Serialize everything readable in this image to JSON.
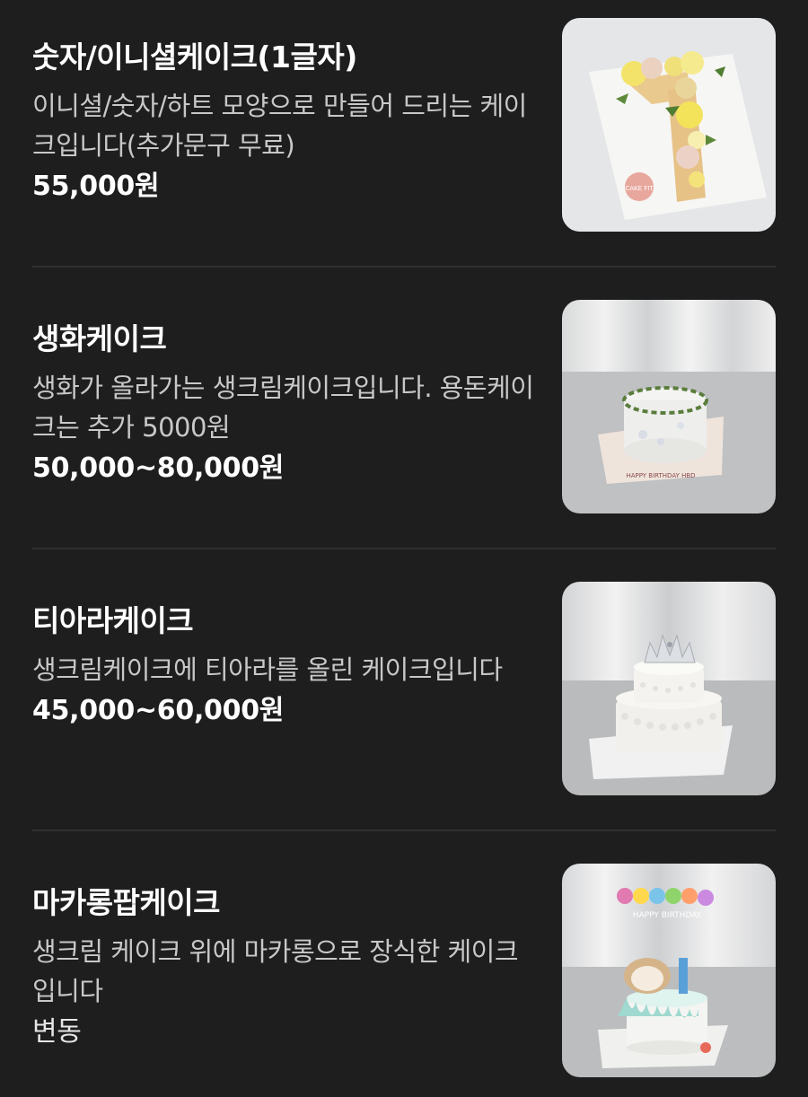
{
  "menu": {
    "items": [
      {
        "name": "숫자/이니셜케이크(1글자)",
        "description": "이니셜/숫자/하트 모양으로 만들어 드리는 케이크입니다(추가문구 무료)",
        "price": "55,000원",
        "image": "number-cake-photo",
        "image_text": "CAKE FIT"
      },
      {
        "name": "생화케이크",
        "description": "생화가 올라가는 생크림케이크입니다. 용돈케이크는 추가 5000원",
        "price": "50,000~80,000원",
        "image": "flower-cake-photo",
        "image_text": "HAPPY BIRTHDAY HBD"
      },
      {
        "name": "티아라케이크",
        "description": "생크림케이크에 티아라를 올린 케이크입니다",
        "price": "45,000~60,000원",
        "image": "tiara-cake-photo"
      },
      {
        "name": "마카롱팝케이크",
        "description": "생크림 케이크 위에 마카롱으로 장식한 케이크입니다",
        "price": "변동",
        "image": "macaron-pop-cake-photo",
        "image_text": "HAPPY BIRTHDAY"
      }
    ]
  },
  "colors": {
    "background": "#1e1e1e",
    "text_primary": "#ffffff",
    "text_secondary": "#c8c8c8",
    "divider": "#2f2f2f"
  }
}
